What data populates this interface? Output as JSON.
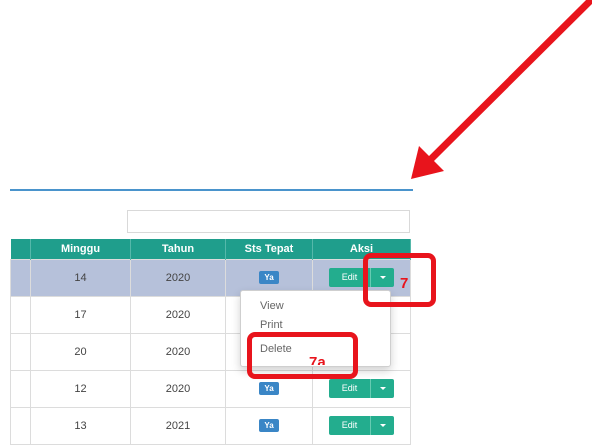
{
  "search": {
    "placeholder": ""
  },
  "table": {
    "headers": {
      "minggu": "Minggu",
      "tahun": "Tahun",
      "sts_tepat": "Sts Tepat",
      "aksi": "Aksi"
    },
    "rows": [
      {
        "minggu": "14",
        "tahun": "2020",
        "sts_tepat": "Ya",
        "aksi": "Edit",
        "selected": true
      },
      {
        "minggu": "17",
        "tahun": "2020"
      },
      {
        "minggu": "20",
        "tahun": "2020"
      },
      {
        "minggu": "12",
        "tahun": "2020",
        "sts_tepat": "Ya",
        "aksi": "Edit"
      },
      {
        "minggu": "13",
        "tahun": "2021",
        "sts_tepat": "Ya",
        "aksi": "Edit"
      }
    ]
  },
  "dropdown": {
    "items": [
      "View",
      "Print",
      "Delete"
    ]
  },
  "annotations": {
    "step_caret": "7",
    "step_delete": "7a"
  },
  "icons": {
    "caret": "caret-down-icon",
    "arrow": "annotation-arrow"
  },
  "colors": {
    "header_bg": "#1f9e8c",
    "button_bg": "#23ad8e",
    "badge_bg": "#3a86c6",
    "selected_row_bg": "#b6c1da",
    "annotation_red": "#e8141c",
    "rule_blue": "#4a94cc"
  }
}
